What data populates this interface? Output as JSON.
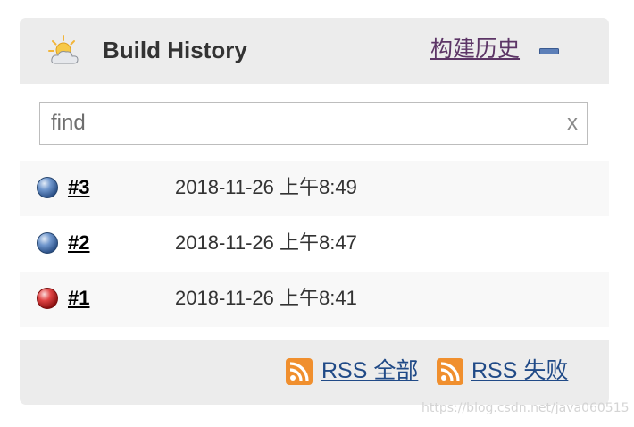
{
  "header": {
    "title": "Build History",
    "link_label": "构建历史",
    "weather_icon": "sunny-cloudy-icon",
    "collapse_icon": "minus-icon"
  },
  "search": {
    "value": "",
    "placeholder": "find",
    "clear_label": "x"
  },
  "builds": [
    {
      "number": "#3",
      "timestamp": "2018-11-26 上午8:49",
      "status": "success",
      "status_color": "#3465a4"
    },
    {
      "number": "#2",
      "timestamp": "2018-11-26 上午8:47",
      "status": "success",
      "status_color": "#3465a4"
    },
    {
      "number": "#1",
      "timestamp": "2018-11-26 上午8:41",
      "status": "failed",
      "status_color": "#cc0000"
    }
  ],
  "footer": {
    "rss_all_label": "RSS 全部",
    "rss_failed_label": "RSS 失败",
    "rss_icon": "rss-feed-icon"
  },
  "watermark": "https://blog.csdn.net/java060515",
  "colors": {
    "header_bg": "#ececec",
    "link_purple": "#5c3566",
    "link_blue": "#204a87",
    "rss_orange": "#f08f2e"
  }
}
